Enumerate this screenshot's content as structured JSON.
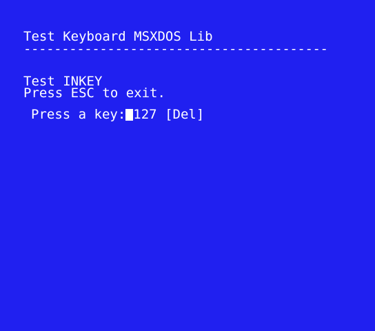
{
  "colors": {
    "background": "#2020f0",
    "text": "#ffffff"
  },
  "screen": {
    "title": "Test Keyboard MSXDOS Lib",
    "rule": "----------------------------------------",
    "test_name": "Test INKEY",
    "instruction": "Press ESC to exit.",
    "prompt_label": "Press a key:",
    "key_code": "127",
    "key_name": "[Del]"
  }
}
